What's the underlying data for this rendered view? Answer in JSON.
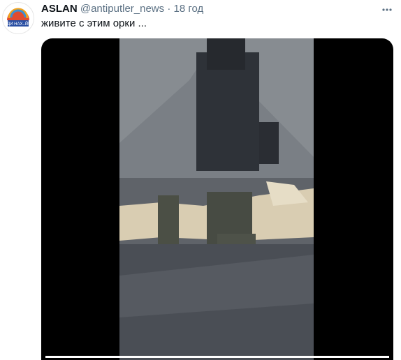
{
  "tweet": {
    "author_name": "ASLAN",
    "handle": "@antiputler_news",
    "separator": "·",
    "time": "18 год",
    "text": "живите с этим орки ...",
    "avatar_label": "ДИ НАХ..Й!"
  },
  "video": {
    "progress_percent": 100
  },
  "colors": {
    "name": "#0f1419",
    "muted": "#5b7083",
    "background": "#ffffff"
  }
}
